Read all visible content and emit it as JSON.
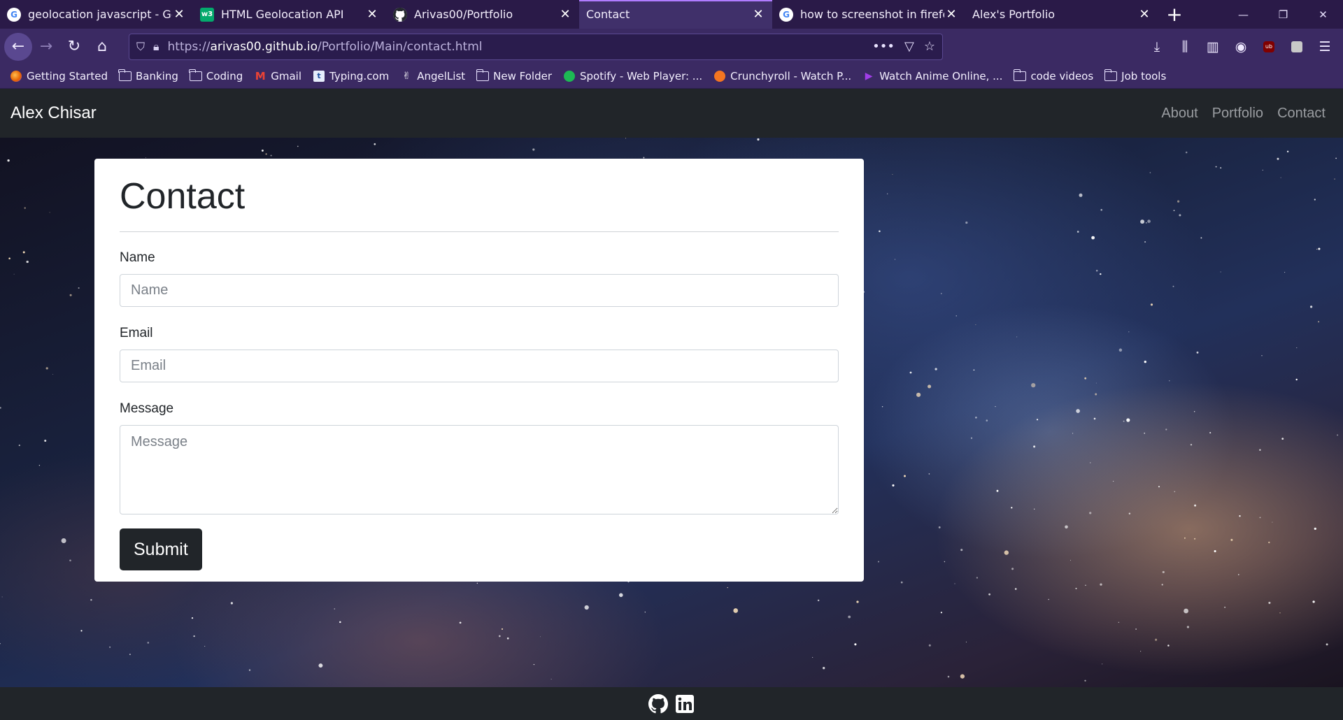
{
  "browser": {
    "tabs": [
      {
        "title": "geolocation javascript - Google Search",
        "favicon": "google-icon"
      },
      {
        "title": "HTML Geolocation API",
        "favicon": "w3schools-icon"
      },
      {
        "title": "Arivas00/Portfolio",
        "favicon": "github-icon"
      },
      {
        "title": "Contact",
        "favicon": "none",
        "active": true
      },
      {
        "title": "how to screenshot in firefox browser",
        "favicon": "google-icon"
      },
      {
        "title": "Alex's Portfolio",
        "favicon": "none"
      }
    ],
    "url": {
      "scheme": "https://",
      "domain": "arivas00.github.io",
      "path": "/Portfolio/Main/contact.html"
    },
    "bookmarks": [
      {
        "label": "Getting Started",
        "icon": "firefox-icon"
      },
      {
        "label": "Banking",
        "icon": "folder-icon"
      },
      {
        "label": "Coding",
        "icon": "folder-icon"
      },
      {
        "label": "Gmail",
        "icon": "gmail-icon"
      },
      {
        "label": "Typing.com",
        "icon": "typing-icon"
      },
      {
        "label": "AngelList",
        "icon": "angellist-icon"
      },
      {
        "label": "New Folder",
        "icon": "folder-icon"
      },
      {
        "label": "Spotify - Web Player: ...",
        "icon": "spotify-icon"
      },
      {
        "label": "Crunchyroll - Watch P...",
        "icon": "crunchyroll-icon"
      },
      {
        "label": "Watch Anime Online, ...",
        "icon": "play-icon"
      },
      {
        "label": "code videos",
        "icon": "folder-icon"
      },
      {
        "label": "Job tools",
        "icon": "folder-icon"
      }
    ]
  },
  "site": {
    "brand": "Alex Chisar",
    "nav": [
      "About",
      "Portfolio",
      "Contact"
    ]
  },
  "form": {
    "title": "Contact",
    "name_label": "Name",
    "name_placeholder": "Name",
    "email_label": "Email",
    "email_placeholder": "Email",
    "message_label": "Message",
    "message_placeholder": "Message",
    "submit_label": "Submit"
  },
  "colors": {
    "chrome_tabstrip": "#2a1a48",
    "chrome_toolbar": "#3b2a63",
    "site_dark": "#212529",
    "active_tab_accent": "#b07cff"
  }
}
